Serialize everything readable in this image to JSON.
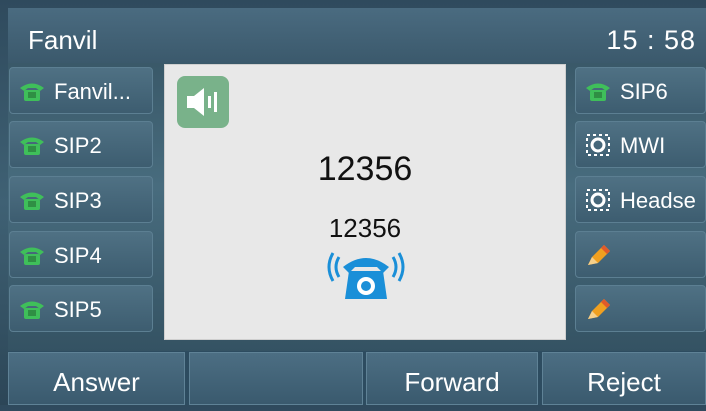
{
  "status": {
    "title": "Fanvil",
    "time": "15 : 58"
  },
  "left_lines": [
    {
      "label": "Fanvil...",
      "icon": "phone-icon"
    },
    {
      "label": "SIP2",
      "icon": "phone-icon"
    },
    {
      "label": "SIP3",
      "icon": "phone-icon"
    },
    {
      "label": "SIP4",
      "icon": "phone-icon"
    },
    {
      "label": "SIP5",
      "icon": "phone-icon"
    }
  ],
  "right_lines": [
    {
      "label": "SIP6",
      "icon": "phone-icon"
    },
    {
      "label": "MWI",
      "icon": "voicemail-icon"
    },
    {
      "label": "Headse",
      "icon": "headset-icon"
    },
    {
      "label": "",
      "icon": "pencil-icon"
    },
    {
      "label": "",
      "icon": "pencil-icon"
    }
  ],
  "call": {
    "number": "12356",
    "name": "12356",
    "status_icon": "ringing-phone-icon",
    "mode_icon": "speaker-icon"
  },
  "softkeys": [
    "Answer",
    "",
    "Forward",
    "Reject"
  ],
  "colors": {
    "accent": "#1a8fd8",
    "line_icon_green": "#3fbf5a",
    "speaker_green": "#79b28a"
  }
}
